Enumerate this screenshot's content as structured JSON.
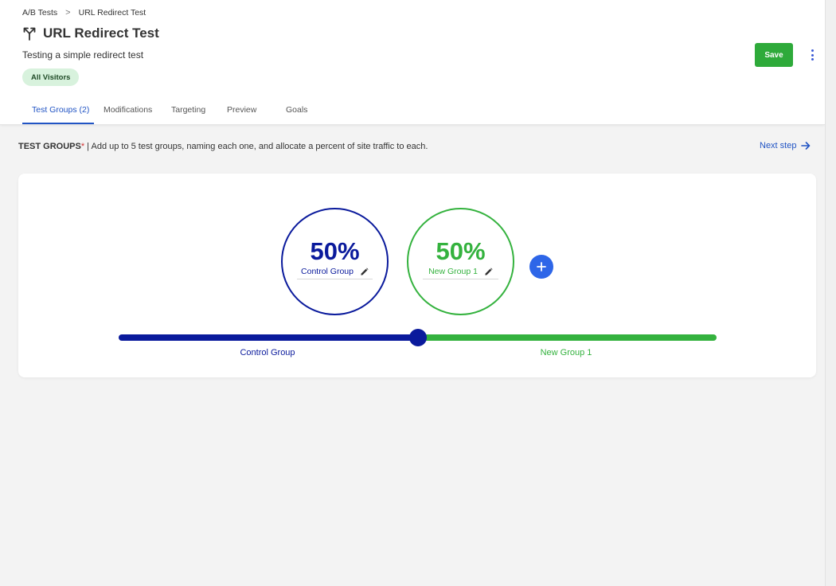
{
  "breadcrumb": {
    "items": [
      "A/B Tests",
      "URL Redirect Test"
    ],
    "separator": ">"
  },
  "header": {
    "title": "URL Redirect Test",
    "title_icon": "split-arrows-icon",
    "description": "Testing a simple redirect test",
    "audience_chip": "All Visitors",
    "save_label": "Save",
    "more_icon": "kebab-menu-icon"
  },
  "tabs": [
    {
      "label": "Test Groups (2)",
      "active": true
    },
    {
      "label": "Modifications",
      "active": false
    },
    {
      "label": "Targeting",
      "active": false
    },
    {
      "label": "Preview",
      "active": false
    },
    {
      "label": "Goals",
      "active": false
    }
  ],
  "section": {
    "label": "TEST GROUPS",
    "required_mark": "*",
    "description": " | Add up to 5 test groups, naming each one, and allocate a percent of site traffic to each.",
    "next_step_label": "Next step"
  },
  "groups": [
    {
      "name": "Control Group",
      "percent": "50%",
      "share": 0.5,
      "color": "#0a1a9c"
    },
    {
      "name": "New Group 1",
      "percent": "50%",
      "share": 0.5,
      "color": "#34b23e"
    }
  ],
  "add_group_icon": "plus-icon",
  "colors": {
    "primary": "#2154c4",
    "save": "#2eaa3a",
    "control": "#0a1a9c",
    "variant": "#34b23e",
    "add_button": "#2e66e8"
  }
}
